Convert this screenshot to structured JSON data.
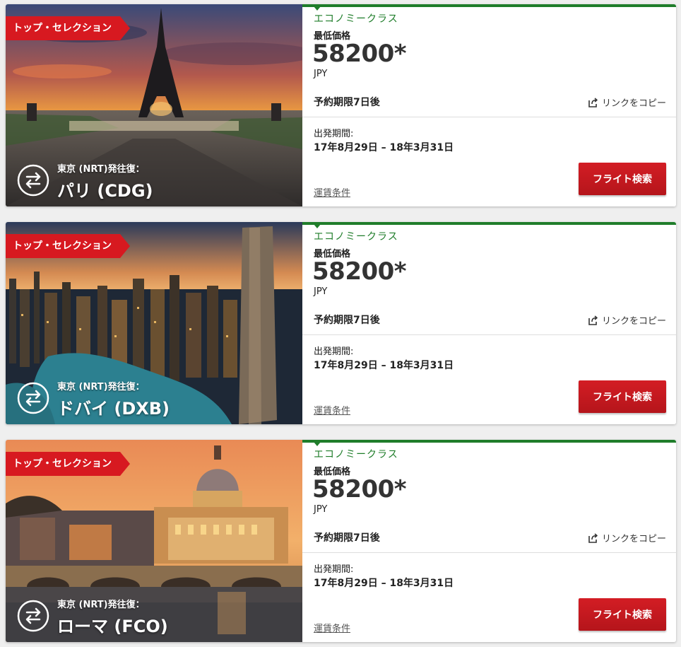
{
  "colors": {
    "accent_red": "#d71920",
    "accent_green": "#1f7d2a"
  },
  "deals": [
    {
      "badge": "トップ・セレクション",
      "route_sub": "東京 (NRT)発往復：",
      "city": "パリ (CDG)",
      "image": "eiffel-tower-sunset",
      "cabin": "エコノミークラス",
      "price_label": "最低価格",
      "price": "58200*",
      "currency": "JPY",
      "deadline": "予約期限7日後",
      "copy_link": "リンクをコピー",
      "period_label": "出発期間:",
      "period": "17年8月29日 – 18年3月31日",
      "fare_terms": "運賃条件",
      "search_button": "フライト検索"
    },
    {
      "badge": "トップ・セレクション",
      "route_sub": "東京 (NRT)発往復：",
      "city": "ドバイ (DXB)",
      "image": "dubai-marina-night",
      "cabin": "エコノミークラス",
      "price_label": "最低価格",
      "price": "58200*",
      "currency": "JPY",
      "deadline": "予約期限7日後",
      "copy_link": "リンクをコピー",
      "period_label": "出発期間:",
      "period": "17年8月29日 – 18年3月31日",
      "fare_terms": "運賃条件",
      "search_button": "フライト検索"
    },
    {
      "badge": "トップ・セレクション",
      "route_sub": "東京 (NRT)発往復：",
      "city": "ローマ (FCO)",
      "image": "rome-st-peters-dusk",
      "cabin": "エコノミークラス",
      "price_label": "最低価格",
      "price": "58200*",
      "currency": "JPY",
      "deadline": "予約期限7日後",
      "copy_link": "リンクをコピー",
      "period_label": "出発期間:",
      "period": "17年8月29日 – 18年3月31日",
      "fare_terms": "運賃条件",
      "search_button": "フライト検索"
    }
  ]
}
